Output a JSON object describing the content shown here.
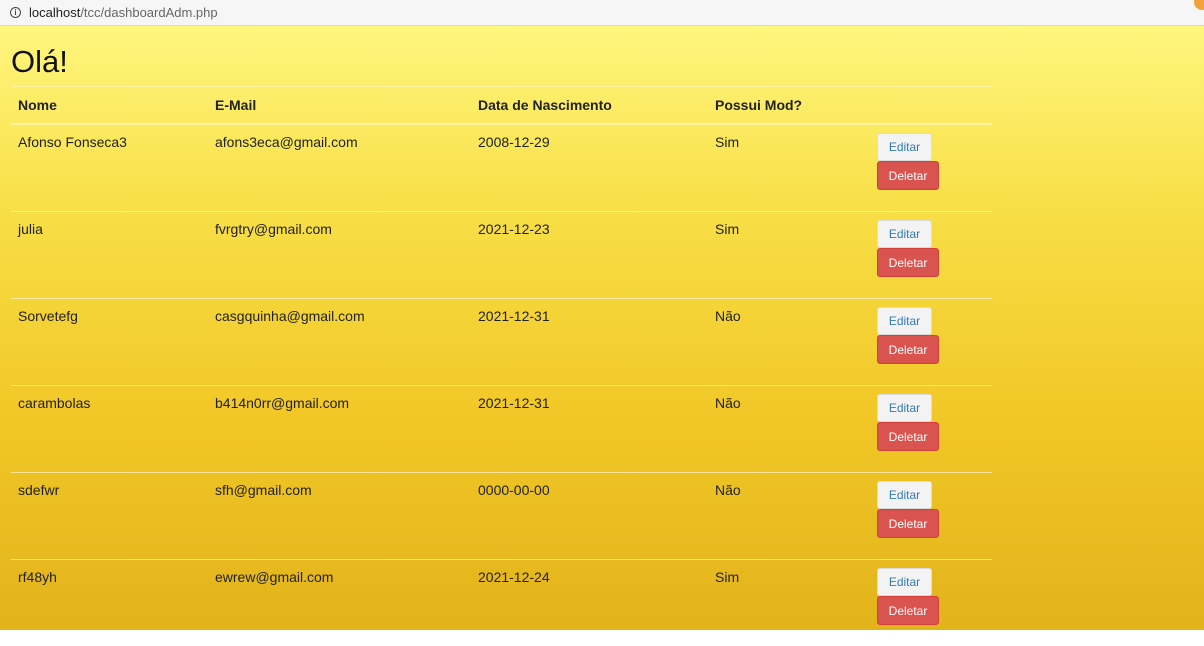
{
  "browser": {
    "url_host": "localhost",
    "url_path": "/tcc/dashboardAdm.php"
  },
  "page": {
    "title": "Olá!"
  },
  "table": {
    "headers": [
      "Nome",
      "E-Mail",
      "Data de Nascimento",
      "Possui Mod?"
    ],
    "rows": [
      {
        "nome": "Afonso Fonseca3",
        "email": "afons3eca@gmail.com",
        "nascimento": "2008-12-29",
        "mod": "Sim"
      },
      {
        "nome": "julia",
        "email": "fvrgtry@gmail.com",
        "nascimento": "2021-12-23",
        "mod": "Sim"
      },
      {
        "nome": "Sorvetefg",
        "email": "casgquinha@gmail.com",
        "nascimento": "2021-12-31",
        "mod": "Não"
      },
      {
        "nome": "carambolas",
        "email": "b414n0rr@gmail.com",
        "nascimento": "2021-12-31",
        "mod": "Não"
      },
      {
        "nome": "sdefwr",
        "email": "sfh@gmail.com",
        "nascimento": "0000-00-00",
        "mod": "Não"
      },
      {
        "nome": "rf48yh",
        "email": "ewrew@gmail.com",
        "nascimento": "2021-12-24",
        "mod": "Sim"
      }
    ],
    "edit_label": "Editar",
    "delete_label": "Deletar"
  },
  "colors": {
    "delete_button": "#d9534f",
    "edit_text": "#337ab7",
    "background_top": "#fff67e",
    "background_bottom": "#e2b31b"
  },
  "icons": {
    "address_bar": "info-icon"
  }
}
